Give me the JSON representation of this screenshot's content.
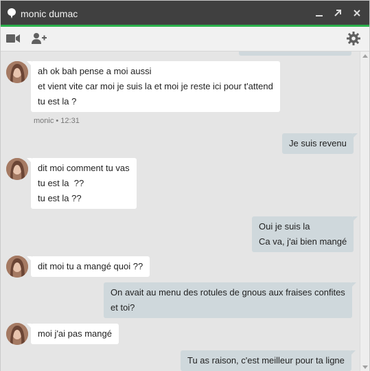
{
  "window": {
    "title": "monic dumac",
    "accent_color": "#2bb24c",
    "titlebar_color": "#404040"
  },
  "toolbar": {
    "icons": [
      "video-camera-icon",
      "add-person-icon",
      "gear-icon"
    ]
  },
  "messages": [
    {
      "side": "in",
      "lines": [
        "ah ok bah pense a moi aussi",
        "et vient vite car moi je suis la et moi je reste ici pour t'attend",
        "tu est la ?"
      ]
    },
    {
      "meta": "monic • 12:31"
    },
    {
      "side": "out",
      "lines": [
        "Je suis revenu"
      ]
    },
    {
      "side": "in",
      "lines": [
        "dit moi comment tu vas",
        "tu est la  ??",
        "tu est la ??"
      ]
    },
    {
      "side": "out",
      "lines": [
        "Oui je suis la",
        "Ca va, j'ai bien mangé"
      ]
    },
    {
      "side": "in",
      "lines": [
        "dit moi tu a mangé quoi ??"
      ]
    },
    {
      "side": "out",
      "lines": [
        "On avait au menu des rotules de gnous aux fraises confites",
        "et toi?"
      ]
    },
    {
      "side": "in",
      "lines": [
        "moi j'ai pas mangé"
      ]
    },
    {
      "side": "out",
      "lines": [
        "Tu as raison, c'est meilleur pour ta ligne"
      ]
    }
  ],
  "colors": {
    "incoming_bubble": "#ffffff",
    "outgoing_bubble": "#cfd8dc",
    "chat_background": "#e5e5e5"
  }
}
